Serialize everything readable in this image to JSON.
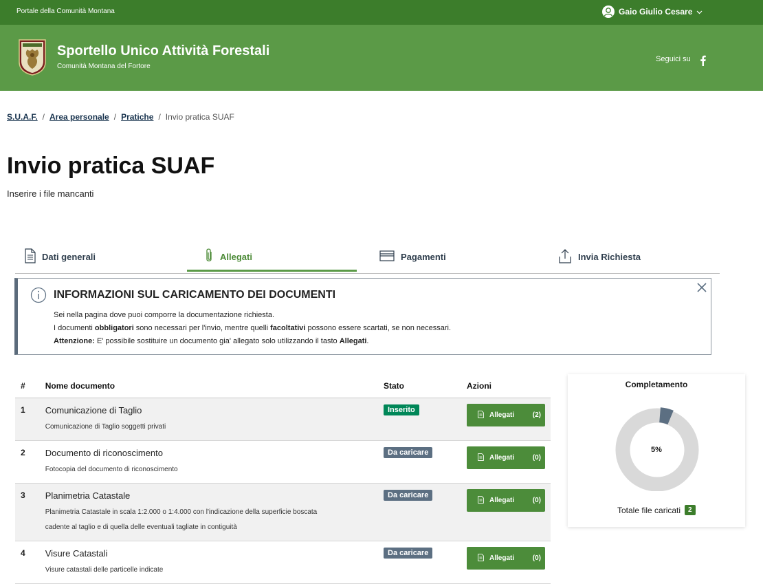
{
  "topbar": {
    "portal": "Portale della Comunità Montana",
    "user": "Gaio Giulio Cesare"
  },
  "header": {
    "title": "Sportello Unico Attività Forestali",
    "subtitle": "Comunità Montana del Fortore",
    "follow": "Seguici su"
  },
  "breadcrumb": {
    "items": [
      "S.U.A.F.",
      "Area personale",
      "Pratiche"
    ],
    "current": "Invio pratica SUAF",
    "separator": "/"
  },
  "page": {
    "title": "Invio pratica SUAF",
    "subtitle": "Inserire i file mancanti"
  },
  "tabs": [
    {
      "label": "Dati generali",
      "icon": "document-icon",
      "active": false
    },
    {
      "label": "Allegati",
      "icon": "paperclip-icon",
      "active": true
    },
    {
      "label": "Pagamenti",
      "icon": "credit-card-icon",
      "active": false
    },
    {
      "label": "Invia Richiesta",
      "icon": "upload-icon",
      "active": false
    }
  ],
  "alert": {
    "title": "INFORMAZIONI SUL CARICAMENTO DEI DOCUMENTI",
    "line1": "Sei nella pagina dove puoi comporre la documentazione richiesta.",
    "line2_a": "I documenti ",
    "line2_b": "obbligatori",
    "line2_c": " sono necessari per l'invio, mentre quelli ",
    "line2_d": "facoltativi",
    "line2_e": " possono essere scartati, se non necessari.",
    "line3_a": "Attenzione:",
    "line3_b": " E' possibile sostituire un documento gia' allegato solo utilizzando il tasto ",
    "line3_c": "Allegati",
    "line3_d": "."
  },
  "table": {
    "headers": {
      "num": "#",
      "name": "Nome documento",
      "status": "Stato",
      "actions": "Azioni"
    },
    "rows": [
      {
        "num": "1",
        "name": "Comunicazione di Taglio",
        "desc": "Comunicazione di Taglio soggetti privati",
        "status": "Inserito",
        "button": "Allegati",
        "count": "(2)"
      },
      {
        "num": "2",
        "name": "Documento di riconoscimento",
        "desc": "Fotocopia del documento di riconoscimento",
        "status": "Da caricare",
        "button": "Allegati",
        "count": "(0)"
      },
      {
        "num": "3",
        "name": "Planimetria Catastale",
        "desc_line1": "Planimetria Catastale in scala 1:2.000 o 1:4.000 con l'indicazione della superficie boscata",
        "desc_line2": "cadente al taglio e di quella delle eventuali tagliate in contiguità",
        "status": "Da caricare",
        "button": "Allegati",
        "count": "(0)"
      },
      {
        "num": "4",
        "name": "Visure Catastali",
        "desc": "Visure catastali delle particelle indicate",
        "status": "Da caricare",
        "button": "Allegati",
        "count": "(0)"
      }
    ]
  },
  "completion": {
    "title": "Completamento",
    "percent": 5,
    "percent_label": "5%",
    "total_label": "Totale file caricati",
    "total_count": "2"
  },
  "colors": {
    "primary": "#5b9a47",
    "dark_green": "#3c7d2b",
    "inserted": "#008758",
    "pending": "#5c6f82",
    "donut_fill": "#5c6f82",
    "donut_track": "#d9d9d9"
  }
}
